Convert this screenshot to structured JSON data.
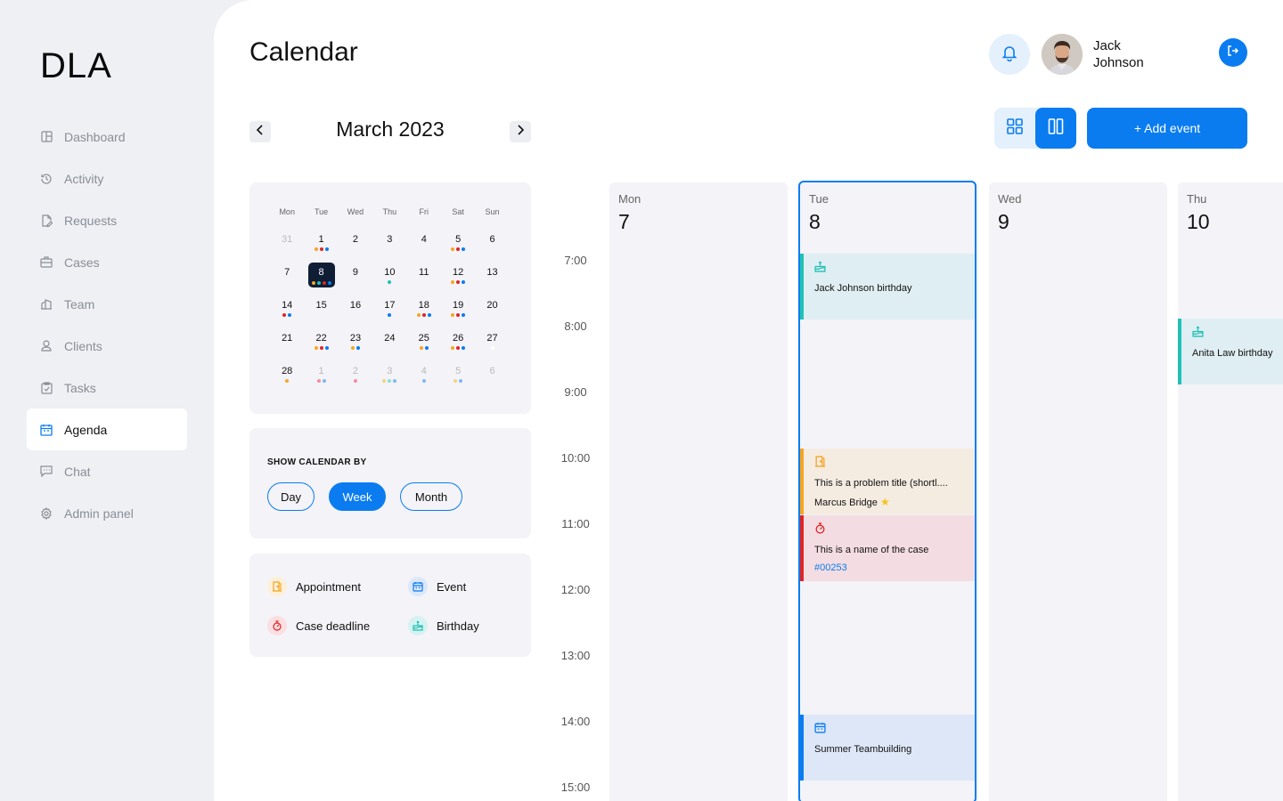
{
  "app": {
    "logo": "DLA"
  },
  "sidebar": {
    "items": [
      {
        "label": "Dashboard",
        "icon": "layout-icon"
      },
      {
        "label": "Activity",
        "icon": "history-icon"
      },
      {
        "label": "Requests",
        "icon": "file-edit-icon"
      },
      {
        "label": "Cases",
        "icon": "briefcase-icon"
      },
      {
        "label": "Team",
        "icon": "building-icon"
      },
      {
        "label": "Clients",
        "icon": "user-icon"
      },
      {
        "label": "Tasks",
        "icon": "clipboard-check-icon"
      },
      {
        "label": "Agenda",
        "icon": "calendar-icon",
        "active": true
      },
      {
        "label": "Chat",
        "icon": "chat-icon"
      },
      {
        "label": "Admin panel",
        "icon": "gear-icon"
      }
    ]
  },
  "header": {
    "title": "Calendar",
    "user": {
      "first": "Jack",
      "last": "Johnson"
    }
  },
  "month_nav": {
    "label": "March 2023"
  },
  "toolbar": {
    "add_event": "+ Add event"
  },
  "mini_calendar": {
    "weekdays": [
      "Mon",
      "Tue",
      "Wed",
      "Thu",
      "Fri",
      "Sat",
      "Sun"
    ],
    "weeks": [
      [
        {
          "d": "31",
          "dim": true
        },
        {
          "d": "1",
          "dots": [
            "#f5a623",
            "#e02424",
            "#0a7cf0"
          ]
        },
        {
          "d": "2"
        },
        {
          "d": "3"
        },
        {
          "d": "4"
        },
        {
          "d": "5",
          "dots": [
            "#f5a623",
            "#e02424",
            "#0a7cf0"
          ]
        },
        {
          "d": "6"
        }
      ],
      [
        {
          "d": "7"
        },
        {
          "d": "8",
          "sel": true,
          "dots": [
            "#f5a623",
            "#21c1b6",
            "#e02424",
            "#0a7cf0"
          ]
        },
        {
          "d": "9"
        },
        {
          "d": "10",
          "dots": [
            "#21c1b6"
          ]
        },
        {
          "d": "11"
        },
        {
          "d": "12",
          "dots": [
            "#f5a623",
            "#e02424",
            "#0a7cf0"
          ]
        },
        {
          "d": "13"
        }
      ],
      [
        {
          "d": "14",
          "dots": [
            "#e02424",
            "#0a7cf0"
          ]
        },
        {
          "d": "15"
        },
        {
          "d": "16"
        },
        {
          "d": "17",
          "dots": [
            "#0a7cf0"
          ]
        },
        {
          "d": "18",
          "dots": [
            "#f5a623",
            "#e02424",
            "#0a7cf0"
          ]
        },
        {
          "d": "19",
          "dots": [
            "#f5a623",
            "#e02424",
            "#0a7cf0"
          ]
        },
        {
          "d": "20"
        }
      ],
      [
        {
          "d": "21"
        },
        {
          "d": "22",
          "dots": [
            "#f5a623",
            "#e02424",
            "#0a7cf0"
          ]
        },
        {
          "d": "23",
          "dots": [
            "#f5a623",
            "#0a7cf0"
          ]
        },
        {
          "d": "24"
        },
        {
          "d": "25",
          "dots": [
            "#f5a623",
            "#0a7cf0"
          ]
        },
        {
          "d": "26",
          "dots": [
            "#f5a623",
            "#e02424",
            "#0a7cf0"
          ]
        },
        {
          "d": "27",
          "dots": [
            "#ffffff"
          ]
        }
      ],
      [
        {
          "d": "28",
          "dots": [
            "#f5a623"
          ]
        },
        {
          "d": "1",
          "dim": true,
          "dots": [
            "#f58ba0",
            "#7fb8f5"
          ]
        },
        {
          "d": "2",
          "dim": true,
          "dots": [
            "#f58ba0"
          ]
        },
        {
          "d": "3",
          "dim": true,
          "dots": [
            "#f5d37a",
            "#8fdcd6",
            "#7fb8f5"
          ]
        },
        {
          "d": "4",
          "dim": true,
          "dots": [
            "#7fb8f5"
          ]
        },
        {
          "d": "5",
          "dim": true,
          "dots": [
            "#f5d37a",
            "#7fb8f5"
          ]
        },
        {
          "d": "6",
          "dim": true
        }
      ]
    ]
  },
  "show_by": {
    "label": "SHOW CALENDAR BY",
    "options": [
      "Day",
      "Week",
      "Month"
    ],
    "selected": "Week"
  },
  "legend": {
    "appointment": "Appointment",
    "event": "Event",
    "case_deadline": "Case deadline",
    "birthday": "Birthday"
  },
  "times": [
    "7:00",
    "8:00",
    "9:00",
    "10:00",
    "11:00",
    "12:00",
    "13:00",
    "14:00",
    "15:00"
  ],
  "days": [
    {
      "name": "Mon",
      "num": "7"
    },
    {
      "name": "Tue",
      "num": "8"
    },
    {
      "name": "Wed",
      "num": "9"
    },
    {
      "name": "Thu",
      "num": "10"
    }
  ],
  "events": {
    "jack_birthday": "Jack Johnson birthday",
    "problem_title": "This is a problem title (shortl....",
    "problem_person": "Marcus Bridge",
    "case_name": "This is a name of the case",
    "case_number": "#00253",
    "teambuilding": "Summer Teambuilding",
    "anita_birthday": "Anita Law birthday"
  },
  "colors": {
    "accent": "#0a7cf0",
    "appointment": "#f5a623",
    "case_deadline": "#e02424",
    "birthday": "#21c1b6",
    "event": "#0a7cf0"
  }
}
